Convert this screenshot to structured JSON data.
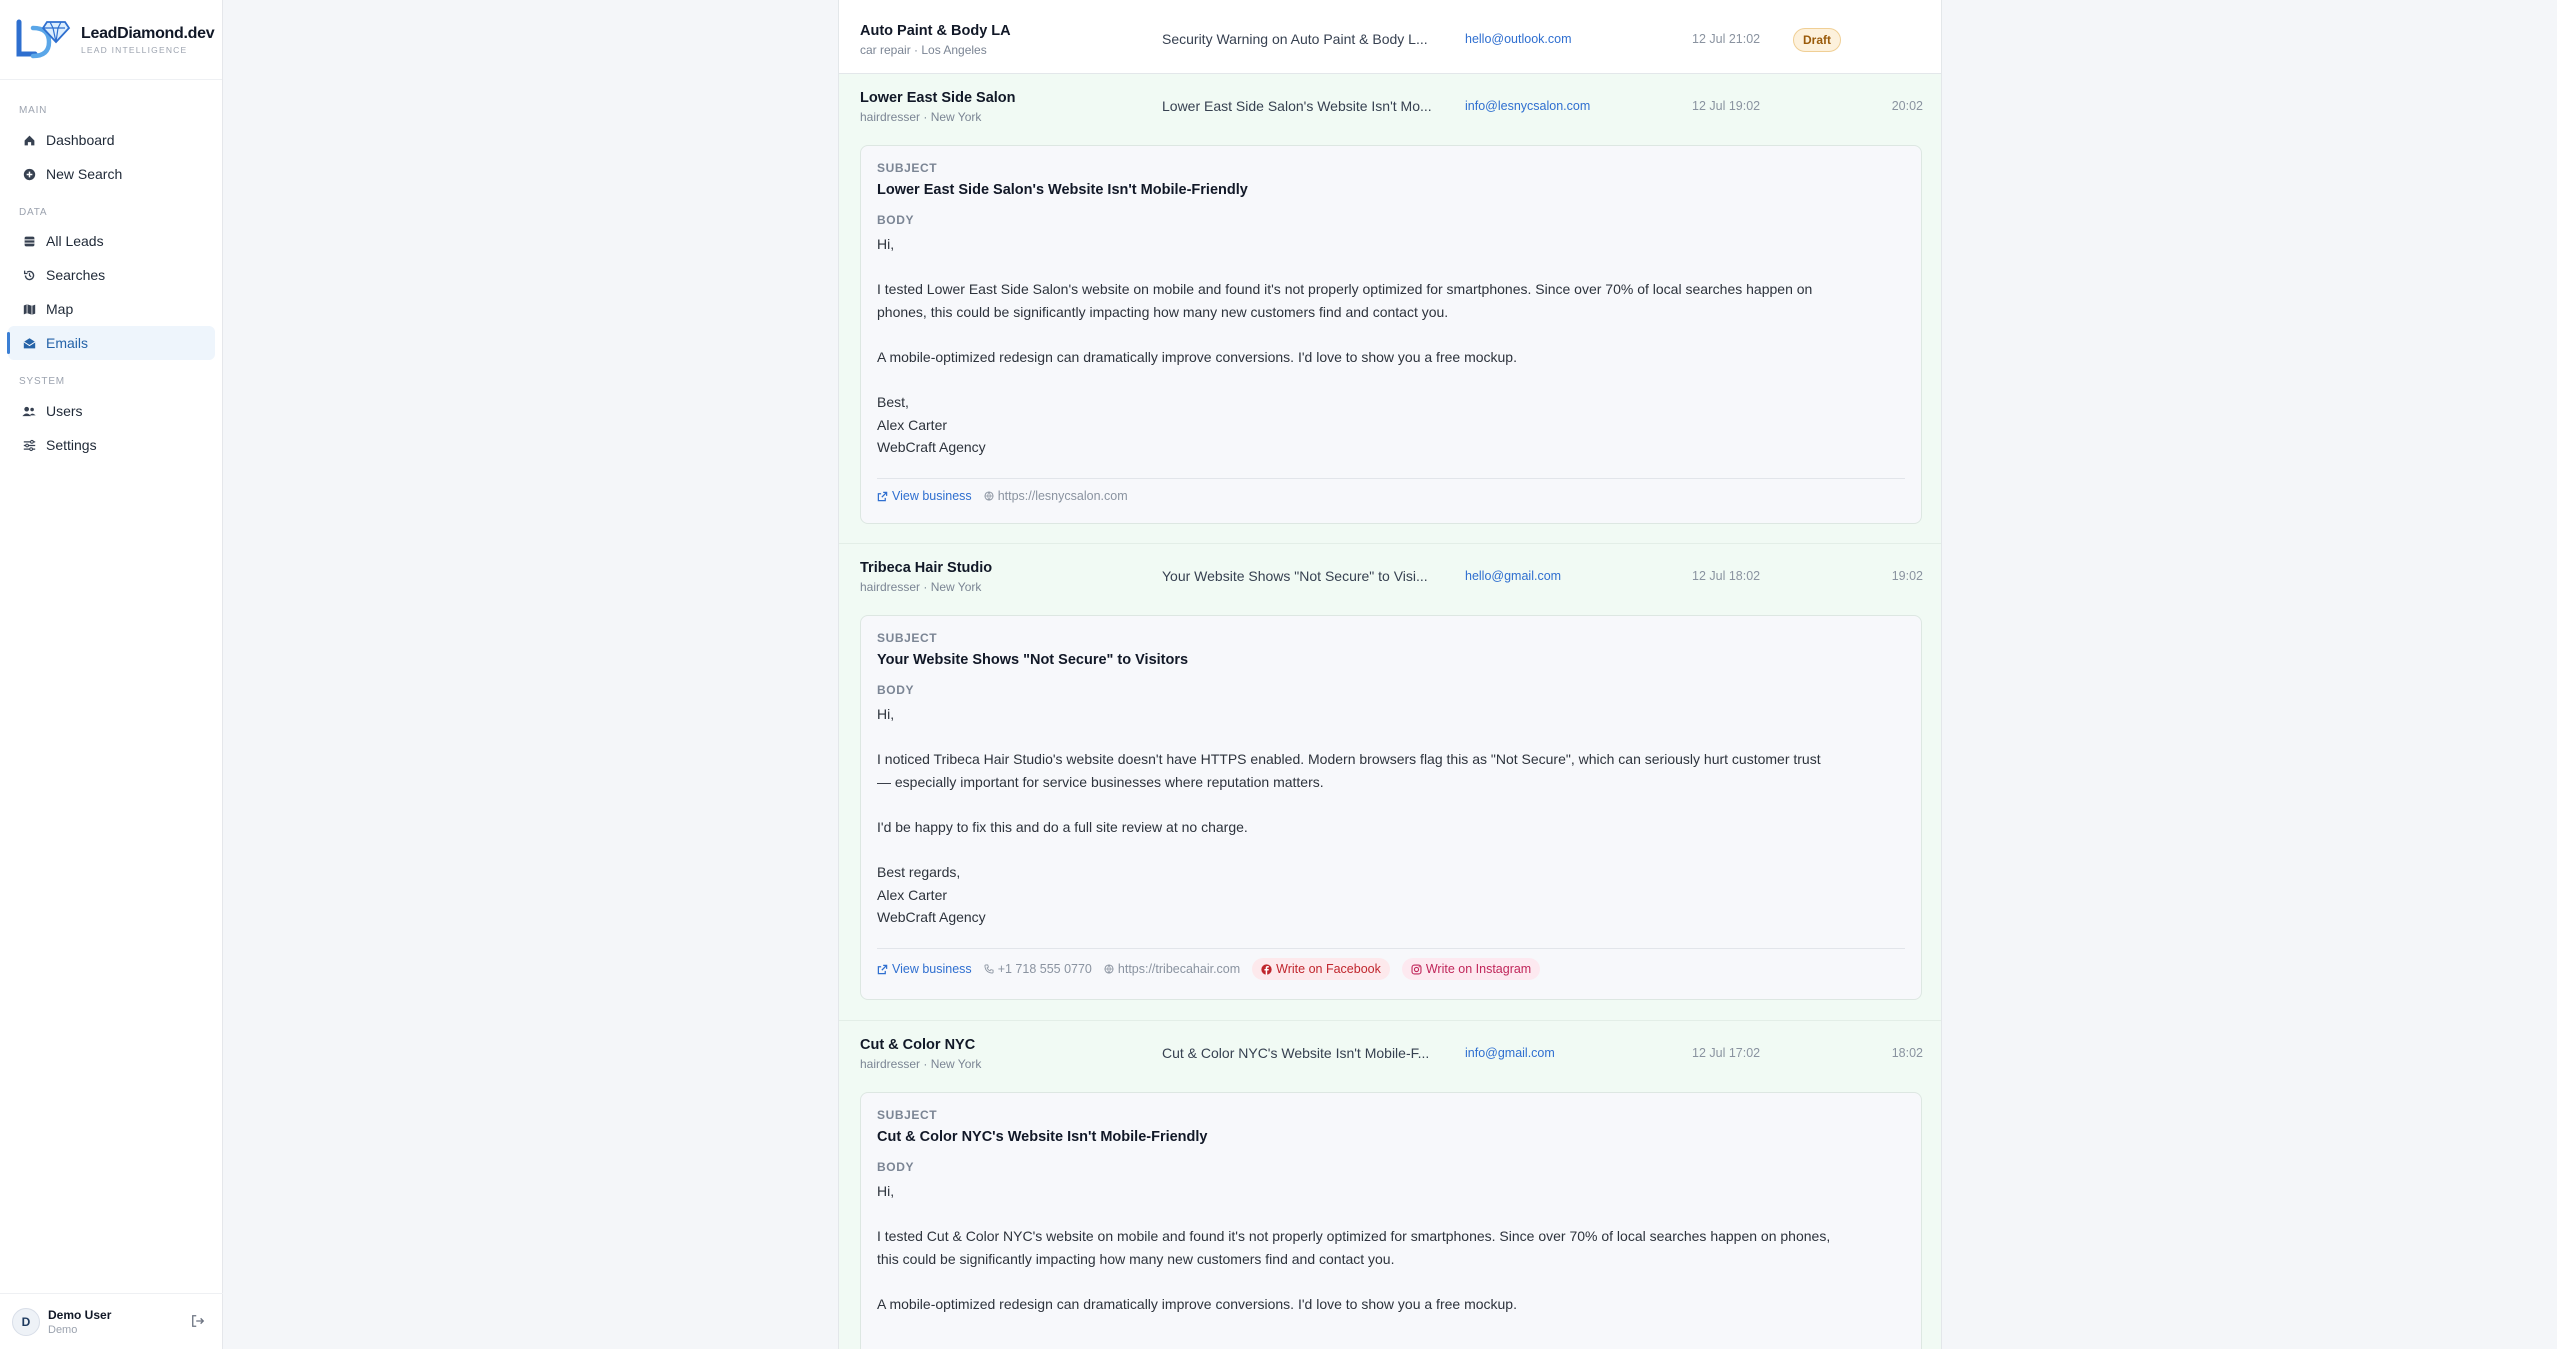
{
  "brand": {
    "name": "LeadDiamond.dev",
    "tagline": "LEAD INTELLIGENCE"
  },
  "nav": {
    "main_label": "MAIN",
    "data_label": "DATA",
    "system_label": "SYSTEM",
    "dashboard": "Dashboard",
    "new_search": "New Search",
    "all_leads": "All Leads",
    "searches": "Searches",
    "map": "Map",
    "emails": "Emails",
    "users": "Users",
    "settings": "Settings"
  },
  "user": {
    "initial": "D",
    "name": "Demo User",
    "role": "Demo"
  },
  "rows": [
    {
      "business": "Auto Paint & Body LA",
      "sub": "car repair · Los Angeles",
      "subject_preview": "Security Warning on Auto Paint & Body L...",
      "email": "hello@outlook.com",
      "date": "12 Jul 21:02",
      "status": "Draft"
    },
    {
      "business": "Lower East Side Salon",
      "sub": "hairdresser · New York",
      "subject_preview": "Lower East Side Salon's Website Isn't Mo...",
      "email": "info@lesnycsalon.com",
      "date": "12 Jul 19:02",
      "time": "20:02",
      "subject_label": "SUBJECT",
      "subject": "Lower East Side Salon's Website Isn't Mobile-Friendly",
      "body_label": "BODY",
      "body": {
        "greeting": "Hi,",
        "p1a": "I tested Lower East Side Salon's website on mobile and found it's not properly optimized for smartphones. Since over 70% of local searches happen on",
        "p1b": "phones, this could be significantly impacting how many new customers find and contact you.",
        "p2": "A mobile-optimized redesign can dramatically improve conversions. I'd love to show you a free mockup.",
        "sign1": "Best,",
        "sign2": "Alex Carter",
        "sign3": "WebCraft Agency"
      },
      "view_business": "View business",
      "website": "https://lesnycsalon.com"
    },
    {
      "business": "Tribeca Hair Studio",
      "sub": "hairdresser · New York",
      "subject_preview": "Your Website Shows \"Not Secure\" to Visi...",
      "email": "hello@gmail.com",
      "date": "12 Jul 18:02",
      "time": "19:02",
      "subject_label": "SUBJECT",
      "subject": "Your Website Shows \"Not Secure\" to Visitors",
      "body_label": "BODY",
      "body": {
        "greeting": "Hi,",
        "p1a": "I noticed Tribeca Hair Studio's website doesn't have HTTPS enabled. Modern browsers flag this as \"Not Secure\", which can seriously hurt customer trust",
        "p1b": "— especially important for service businesses where reputation matters.",
        "p2": "I'd be happy to fix this and do a full site review at no charge.",
        "sign1": "Best regards,",
        "sign2": "Alex Carter",
        "sign3": "WebCraft Agency"
      },
      "view_business": "View business",
      "phone": "+1 718 555 0770",
      "website": "https://tribecahair.com",
      "facebook": "Write on Facebook",
      "instagram": "Write on Instagram"
    },
    {
      "business": "Cut & Color NYC",
      "sub": "hairdresser · New York",
      "subject_preview": "Cut & Color NYC's Website Isn't Mobile-F...",
      "email": "info@gmail.com",
      "date": "12 Jul 17:02",
      "time": "18:02",
      "subject_label": "SUBJECT",
      "subject": "Cut & Color NYC's Website Isn't Mobile-Friendly",
      "body_label": "BODY",
      "body": {
        "greeting": "Hi,",
        "p1a": "I tested Cut & Color NYC's website on mobile and found it's not properly optimized for smartphones. Since over 70% of local searches happen on phones,",
        "p1b": "this could be significantly impacting how many new customers find and contact you.",
        "p2": "A mobile-optimized redesign can dramatically improve conversions. I'd love to show you a free mockup."
      }
    }
  ],
  "colors": {
    "accent": "#3b7fd4",
    "link": "#2f6fd0",
    "row_bg": "#f1faf4",
    "draft_bg": "#fdf1dc"
  }
}
